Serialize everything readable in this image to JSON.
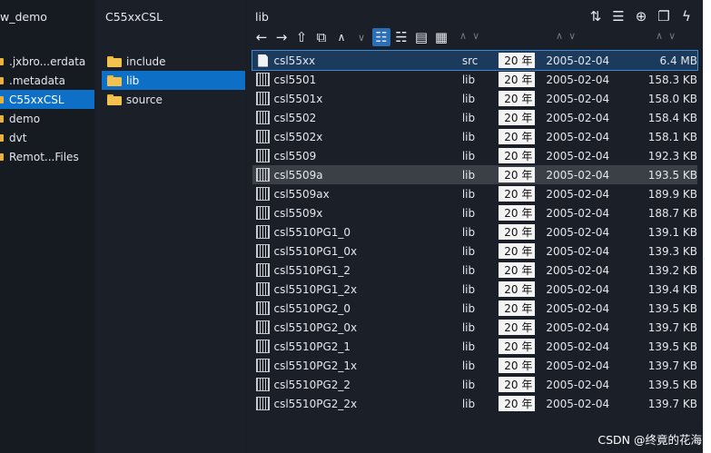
{
  "column1": {
    "crumb": "w_demo",
    "items": [
      {
        "label": ".jxbro...erdata",
        "selected": false
      },
      {
        "label": ".metadata",
        "selected": false
      },
      {
        "label": "C55xxCSL",
        "selected": true
      },
      {
        "label": "demo",
        "selected": false
      },
      {
        "label": "dvt",
        "selected": false
      },
      {
        "label": "Remot...Files",
        "selected": false
      }
    ]
  },
  "column2": {
    "crumb": "C55xxCSL",
    "items": [
      {
        "label": "include",
        "selected": false
      },
      {
        "label": "lib",
        "selected": true
      },
      {
        "label": "source",
        "selected": false
      }
    ]
  },
  "column3": {
    "crumb": "lib",
    "files": [
      {
        "name": "csl55xx",
        "ext": "src",
        "year": "20 年",
        "date": "2005-02-04",
        "size": "6.4 MB",
        "icon": "doc-icon",
        "state": "selected"
      },
      {
        "name": "csl5501",
        "ext": "lib",
        "year": "20 年",
        "date": "2005-02-04",
        "size": "158.3 KB",
        "icon": "lib-icon",
        "state": ""
      },
      {
        "name": "csl5501x",
        "ext": "lib",
        "year": "20 年",
        "date": "2005-02-04",
        "size": "158.0 KB",
        "icon": "lib-icon",
        "state": ""
      },
      {
        "name": "csl5502",
        "ext": "lib",
        "year": "20 年",
        "date": "2005-02-04",
        "size": "158.4 KB",
        "icon": "lib-icon",
        "state": ""
      },
      {
        "name": "csl5502x",
        "ext": "lib",
        "year": "20 年",
        "date": "2005-02-04",
        "size": "158.1 KB",
        "icon": "lib-icon",
        "state": ""
      },
      {
        "name": "csl5509",
        "ext": "lib",
        "year": "20 年",
        "date": "2005-02-04",
        "size": "192.3 KB",
        "icon": "lib-icon",
        "state": ""
      },
      {
        "name": "csl5509a",
        "ext": "lib",
        "year": "20 年",
        "date": "2005-02-04",
        "size": "193.5 KB",
        "icon": "lib-icon",
        "state": "hover"
      },
      {
        "name": "csl5509ax",
        "ext": "lib",
        "year": "20 年",
        "date": "2005-02-04",
        "size": "189.9 KB",
        "icon": "lib-icon",
        "state": ""
      },
      {
        "name": "csl5509x",
        "ext": "lib",
        "year": "20 年",
        "date": "2005-02-04",
        "size": "188.7 KB",
        "icon": "lib-icon",
        "state": ""
      },
      {
        "name": "csl5510PG1_0",
        "ext": "lib",
        "year": "20 年",
        "date": "2005-02-04",
        "size": "139.1 KB",
        "icon": "lib-icon",
        "state": ""
      },
      {
        "name": "csl5510PG1_0x",
        "ext": "lib",
        "year": "20 年",
        "date": "2005-02-04",
        "size": "139.3 KB",
        "icon": "lib-icon",
        "state": ""
      },
      {
        "name": "csl5510PG1_2",
        "ext": "lib",
        "year": "20 年",
        "date": "2005-02-04",
        "size": "139.2 KB",
        "icon": "lib-icon",
        "state": ""
      },
      {
        "name": "csl5510PG1_2x",
        "ext": "lib",
        "year": "20 年",
        "date": "2005-02-04",
        "size": "139.4 KB",
        "icon": "lib-icon",
        "state": ""
      },
      {
        "name": "csl5510PG2_0",
        "ext": "lib",
        "year": "20 年",
        "date": "2005-02-04",
        "size": "139.5 KB",
        "icon": "lib-icon",
        "state": ""
      },
      {
        "name": "csl5510PG2_0x",
        "ext": "lib",
        "year": "20 年",
        "date": "2005-02-04",
        "size": "139.7 KB",
        "icon": "lib-icon",
        "state": ""
      },
      {
        "name": "csl5510PG2_1",
        "ext": "lib",
        "year": "20 年",
        "date": "2005-02-04",
        "size": "139.5 KB",
        "icon": "lib-icon",
        "state": ""
      },
      {
        "name": "csl5510PG2_1x",
        "ext": "lib",
        "year": "20 年",
        "date": "2005-02-04",
        "size": "139.7 KB",
        "icon": "lib-icon",
        "state": ""
      },
      {
        "name": "csl5510PG2_2",
        "ext": "lib",
        "year": "20 年",
        "date": "2005-02-04",
        "size": "139.5 KB",
        "icon": "lib-icon",
        "state": ""
      },
      {
        "name": "csl5510PG2_2x",
        "ext": "lib",
        "year": "20 年",
        "date": "2005-02-04",
        "size": "139.7 KB",
        "icon": "lib-icon",
        "state": ""
      }
    ]
  },
  "toolbar": {
    "top_icons": [
      "sort-icon",
      "list-settings-icon",
      "add-icon",
      "clipboard-icon",
      "action-icon",
      "more-icon"
    ],
    "nav_icons": [
      "back-icon",
      "forward-icon",
      "parent-folder-icon",
      "new-folder-icon",
      "collapse-icon"
    ],
    "view_icons": [
      "list-view-icon",
      "detail-view-icon",
      "gallery-view-icon",
      "grid-view-icon"
    ]
  },
  "watermark": "CSDN @终竟的花海",
  "colors": {
    "accent": "#0e6fc7",
    "background": "#1b1f27",
    "selected_row": "#1b3a5c",
    "hover_row": "#3b3f46"
  }
}
